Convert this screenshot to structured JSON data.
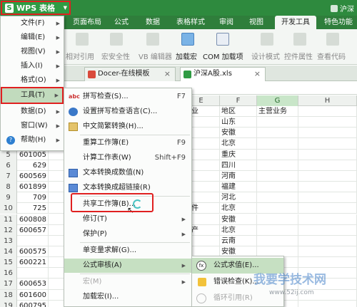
{
  "title_bar": {
    "app_name": "WPS 表格",
    "logo_letter": "S",
    "right_text": "沪深"
  },
  "ribbon_tabs": [
    "页面布局",
    "公式",
    "数据",
    "表格样式",
    "审阅",
    "视图",
    "开发工具",
    "特色功能"
  ],
  "active_tab": "开发工具",
  "ribbon_buttons": [
    {
      "label": "相对引用",
      "enabled": false
    },
    {
      "label": "宏安全性",
      "enabled": false
    },
    {
      "label": "VB 编辑器",
      "enabled": false
    },
    {
      "label": "加载宏",
      "enabled": true
    },
    {
      "label": "COM 加载项",
      "enabled": true
    },
    {
      "label": "设计模式",
      "enabled": false
    },
    {
      "label": "控件属性",
      "enabled": false
    },
    {
      "label": "查看代码",
      "enabled": false
    }
  ],
  "doc_tabs": [
    {
      "label": "Docer-在线模板"
    },
    {
      "label": "沪深A股.xls"
    }
  ],
  "file_menu": [
    {
      "label": "文件(F)",
      "has_sub": true
    },
    {
      "label": "编辑(E)",
      "has_sub": true
    },
    {
      "label": "视图(V)",
      "has_sub": true
    },
    {
      "label": "插入(I)",
      "has_sub": true
    },
    {
      "label": "格式(O)",
      "has_sub": true
    },
    {
      "label": "工具(T)",
      "has_sub": true,
      "highlighted": true
    },
    {
      "label": "数据(D)",
      "has_sub": true
    },
    {
      "label": "窗口(W)",
      "has_sub": true
    },
    {
      "label": "帮助(H)",
      "has_sub": true
    }
  ],
  "tools_menu": [
    {
      "label": "拼写检查(S)...",
      "shortcut": "F7",
      "enabled": true
    },
    {
      "label": "设置拼写检查语言(C)...",
      "enabled": true
    },
    {
      "label": "中文简繁转换(H)...",
      "enabled": true
    },
    {
      "label": "重算工作簿(E)",
      "shortcut": "F9",
      "enabled": true
    },
    {
      "label": "计算工作表(W)",
      "shortcut": "Shift+F9",
      "enabled": true
    },
    {
      "label": "文本转换成数值(N)",
      "enabled": true
    },
    {
      "label": "文本转换成超链接(R)",
      "enabled": true
    },
    {
      "label": "共享工作簿(B)...",
      "enabled": true
    },
    {
      "label": "修订(T)",
      "has_sub": true,
      "enabled": true
    },
    {
      "label": "保护(P)",
      "has_sub": true,
      "enabled": true
    },
    {
      "label": "单变量求解(G)...",
      "enabled": true
    },
    {
      "label": "公式审核(A)",
      "has_sub": true,
      "enabled": true,
      "highlighted": true
    },
    {
      "label": "宏(M)",
      "has_sub": true,
      "enabled": false
    },
    {
      "label": "加载宏(I)...",
      "enabled": true
    }
  ],
  "submenu": [
    {
      "label": "公式求值(E)...",
      "highlighted": true,
      "enabled": true
    },
    {
      "label": "错误检查(K)...",
      "enabled": true
    },
    {
      "label": "循环引用(R)",
      "enabled": false
    }
  ],
  "columns": [
    "E",
    "F",
    "G",
    "H"
  ],
  "selected_column": "G",
  "sheet_header": {
    "E": "行业",
    "F": "地区",
    "G": "主营业务"
  },
  "visible_rows": [
    {
      "num": "",
      "A": "",
      "E": "",
      "F": ""
    },
    {
      "num": "",
      "A": "",
      "E": "",
      "F": "山东"
    },
    {
      "num": "",
      "A": "",
      "E": "",
      "F": "安徽"
    },
    {
      "num": "",
      "A": "",
      "E": "",
      "F": "北京"
    },
    {
      "num": "5",
      "A": "601005",
      "E": "",
      "F": "重庆"
    },
    {
      "num": "6",
      "A": "629",
      "E": "",
      "F": "四川"
    },
    {
      "num": "7",
      "A": "600569",
      "E": "",
      "F": "河南"
    },
    {
      "num": "8",
      "A": "601899",
      "E": "",
      "F": "福建"
    },
    {
      "num": "9",
      "A": "709",
      "E": "",
      "F": "河北"
    },
    {
      "num": "10",
      "A": "725",
      "E": "器件",
      "F": "北京"
    },
    {
      "num": "11",
      "A": "600808",
      "E": "",
      "F": "安徽"
    },
    {
      "num": "12",
      "A": "600657",
      "E": "地产",
      "F": "北京"
    },
    {
      "num": "13",
      "A": "",
      "E": "",
      "F": "云南"
    },
    {
      "num": "14",
      "A": "600575",
      "E": "",
      "F": "安徽"
    },
    {
      "num": "15",
      "A": "600221",
      "E": "",
      "F": "海南"
    },
    {
      "num": "16",
      "A": "",
      "E": "",
      "F": ""
    },
    {
      "num": "17",
      "A": "600653",
      "E": "",
      "F": ""
    },
    {
      "num": "18",
      "A": "601600",
      "E": "",
      "F": ""
    },
    {
      "num": "19",
      "A": "600795",
      "E": "",
      "F": ""
    },
    {
      "num": "20",
      "A": "600010",
      "E": "",
      "F": ""
    }
  ],
  "watermark": {
    "text": "我要学技术网",
    "url": "www.52ij.com"
  }
}
